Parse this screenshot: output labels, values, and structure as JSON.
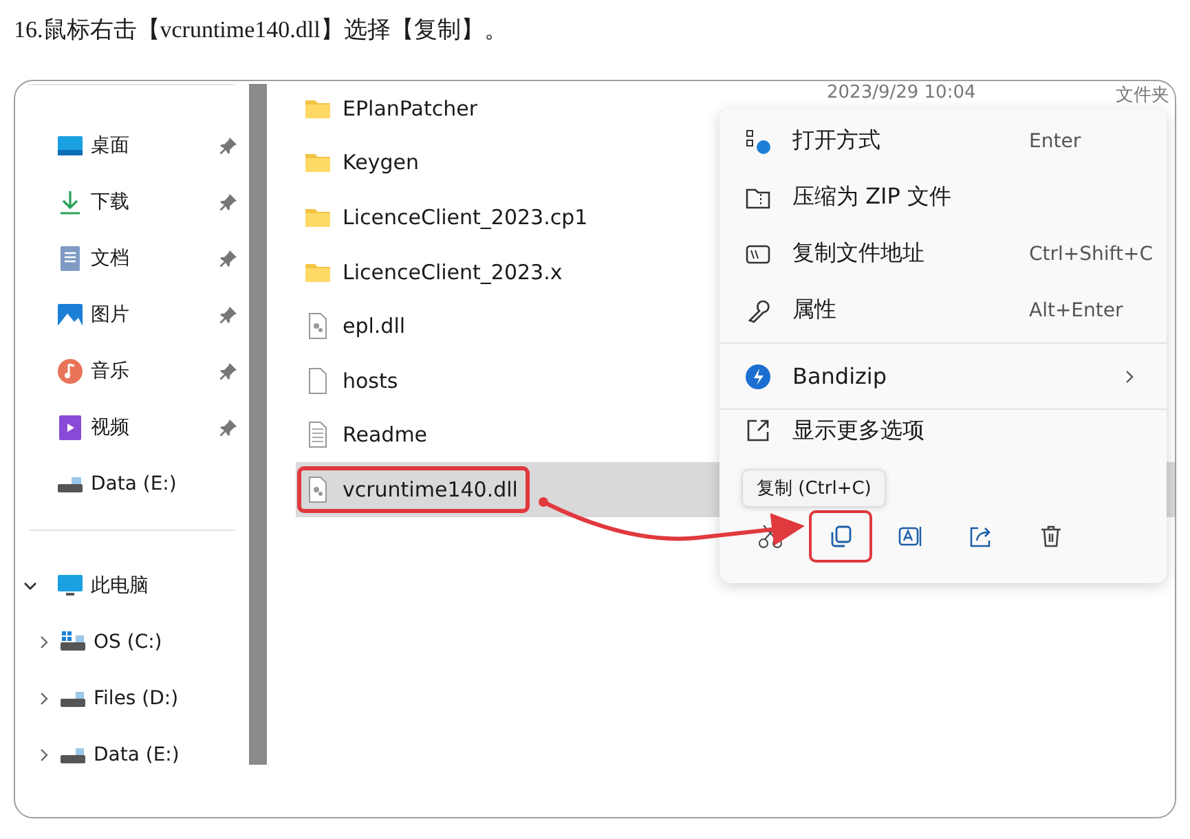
{
  "instruction": "16.鼠标右击【vcruntime140.dll】选择【复制】。",
  "sidebar": {
    "quick_access": [
      {
        "label": "桌面",
        "kind": "desktop",
        "pinned": true
      },
      {
        "label": "下载",
        "kind": "download",
        "pinned": true
      },
      {
        "label": "文档",
        "kind": "document",
        "pinned": true
      },
      {
        "label": "图片",
        "kind": "pictures",
        "pinned": true
      },
      {
        "label": "音乐",
        "kind": "music",
        "pinned": true
      },
      {
        "label": "视频",
        "kind": "video",
        "pinned": true
      },
      {
        "label": "Data (E:)",
        "kind": "drive",
        "pinned": false
      }
    ],
    "this_pc": {
      "label": "此电脑",
      "expanded": true,
      "children": [
        {
          "label": "OS (C:)",
          "kind": "system-drive",
          "expanded": false
        },
        {
          "label": "Files (D:)",
          "kind": "drive",
          "expanded": false
        },
        {
          "label": "Data (E:)",
          "kind": "drive",
          "expanded": false
        }
      ]
    }
  },
  "files": [
    {
      "name": "EPlanPatcher",
      "kind": "folder",
      "date": "2023/9/29 10:04",
      "type": "文件夹",
      "selected": false,
      "highlighted": false
    },
    {
      "name": "Keygen",
      "kind": "folder",
      "selected": false,
      "highlighted": false
    },
    {
      "name": "LicenceClient_2023.cp1",
      "kind": "folder",
      "selected": false,
      "highlighted": false
    },
    {
      "name": "LicenceClient_2023.x",
      "kind": "folder",
      "selected": false,
      "highlighted": false
    },
    {
      "name": "epl.dll",
      "kind": "dll",
      "selected": false,
      "highlighted": false
    },
    {
      "name": "hosts",
      "kind": "file",
      "selected": false,
      "highlighted": false
    },
    {
      "name": "Readme",
      "kind": "text",
      "selected": false,
      "highlighted": false
    },
    {
      "name": "vcruntime140.dll",
      "kind": "dll",
      "selected": true,
      "highlighted": true
    }
  ],
  "context_menu": {
    "items": [
      {
        "label": "打开方式",
        "shortcut": "Enter",
        "kind": "open-with"
      },
      {
        "label": "压缩为 ZIP 文件",
        "kind": "zip"
      },
      {
        "label": "复制文件地址",
        "shortcut": "Ctrl+Shift+C",
        "kind": "path"
      },
      {
        "label": "属性",
        "shortcut": "Alt+Enter",
        "kind": "properties"
      }
    ],
    "submenu": {
      "label": "Bandizip"
    },
    "more": "显示更多选项",
    "actions": [
      {
        "kind": "cut",
        "highlighted": false
      },
      {
        "kind": "copy",
        "highlighted": true
      },
      {
        "kind": "rename",
        "highlighted": false
      },
      {
        "kind": "share",
        "highlighted": false
      },
      {
        "kind": "delete",
        "highlighted": false
      }
    ],
    "tooltip": "复制 (Ctrl+C)"
  }
}
